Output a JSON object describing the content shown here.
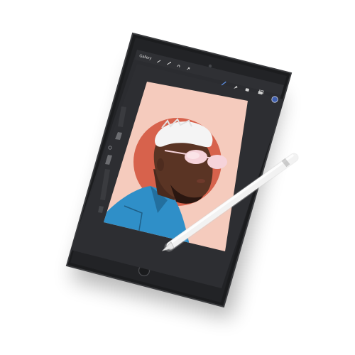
{
  "toolbar": {
    "gallery_label": "Gallery",
    "tool_icons": [
      "wrench-icon",
      "magic-wand-icon",
      "selection-icon",
      "transform-icon"
    ],
    "brush_icons": [
      "brush-icon",
      "smudge-icon",
      "eraser-icon",
      "layers-icon"
    ],
    "active_color": "#3f5fae"
  },
  "canvas": {
    "background_color": "#f5cbbd",
    "sun_color": "#d7624c",
    "hair_color": "#f4f4f4",
    "skin_color": "#5a3424",
    "glasses_color": "#f6d3da",
    "jacket_color": "#2f8fc8"
  },
  "device": {
    "bezel_color": "#202124"
  }
}
